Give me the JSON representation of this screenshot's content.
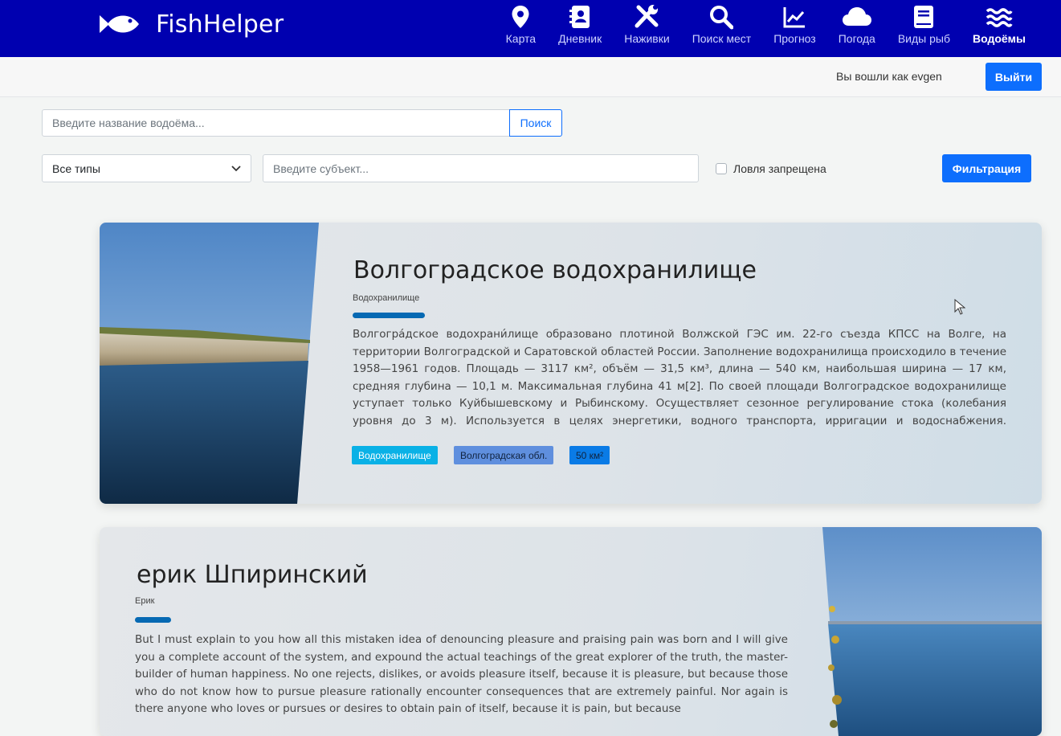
{
  "app": {
    "name": "FishHelper"
  },
  "nav": {
    "items": [
      {
        "label": "Карта",
        "icon": "map-pin-icon"
      },
      {
        "label": "Дневник",
        "icon": "diary-icon"
      },
      {
        "label": "Наживки",
        "icon": "tools-icon"
      },
      {
        "label": "Поиск мест",
        "icon": "search-icon"
      },
      {
        "label": "Прогноз",
        "icon": "chart-icon"
      },
      {
        "label": "Погода",
        "icon": "cloud-icon"
      },
      {
        "label": "Виды рыб",
        "icon": "book-icon"
      },
      {
        "label": "Водоёмы",
        "icon": "water-icon",
        "active": true
      }
    ]
  },
  "user": {
    "logged_in_text": "Вы вошли как evgen",
    "logout_label": "Выйти"
  },
  "search": {
    "placeholder": "Введите название водоёма...",
    "button_label": "Поиск"
  },
  "filters": {
    "type_select_value": "Все типы",
    "subject_placeholder": "Введите субъект...",
    "fishing_banned_label": "Ловля запрещена",
    "fishing_banned_checked": false,
    "filter_button_label": "Фильтрация"
  },
  "colors": {
    "navbar": "#0000b0",
    "primary": "#0d6efd",
    "tag_type": "#0ab1e6",
    "tag_region": "#5f8fde",
    "tag_area": "#0a7be6"
  },
  "reservoirs": [
    {
      "title": "Волгоградское водохранилище",
      "type": "Водохранилище",
      "description": "Волгогра́дское водохрани́лище образовано плотиной Волжской ГЭС им. 22-го съезда КПСС на Волге, на территории Волгоградской и Саратовской областей России. Заполнение водохранилища происходило в течение 1958—1961 годов. Площадь — 3117 км², объём — 31,5 км³, длина — 540 км, наибольшая ширина — 17 км, средняя глубина — 10,1 м. Максимальная глубина 41 м[2]. По своей площади Волгоградское водохранилище уступает только Куйбышевскому и Рыбинскому. Осуществляет сезонное регулирование стока (колебания уровня до 3 м). Используется в целях энергетики, водного транспорта, ирригации и водоснабжения. Рыболовство (лещ, судак,",
      "tags": [
        "Водохранилище",
        "Волгоградская обл.",
        "50 км²"
      ]
    },
    {
      "title": "ерик Шпиринский",
      "type": "Ерик",
      "description": "But I must explain to you how all this mistaken idea of denouncing pleasure and praising pain was born and I will give you a complete account of the system, and expound the actual teachings of the great explorer of the truth, the master-builder of human happiness. No one rejects, dislikes, or avoids pleasure itself, because it is pleasure, but because those who do not know how to pursue pleasure rationally encounter consequences that are extremely painful. Nor again is there anyone who loves or pursues or desires to obtain pain of itself, because it is pain, but because"
    }
  ]
}
